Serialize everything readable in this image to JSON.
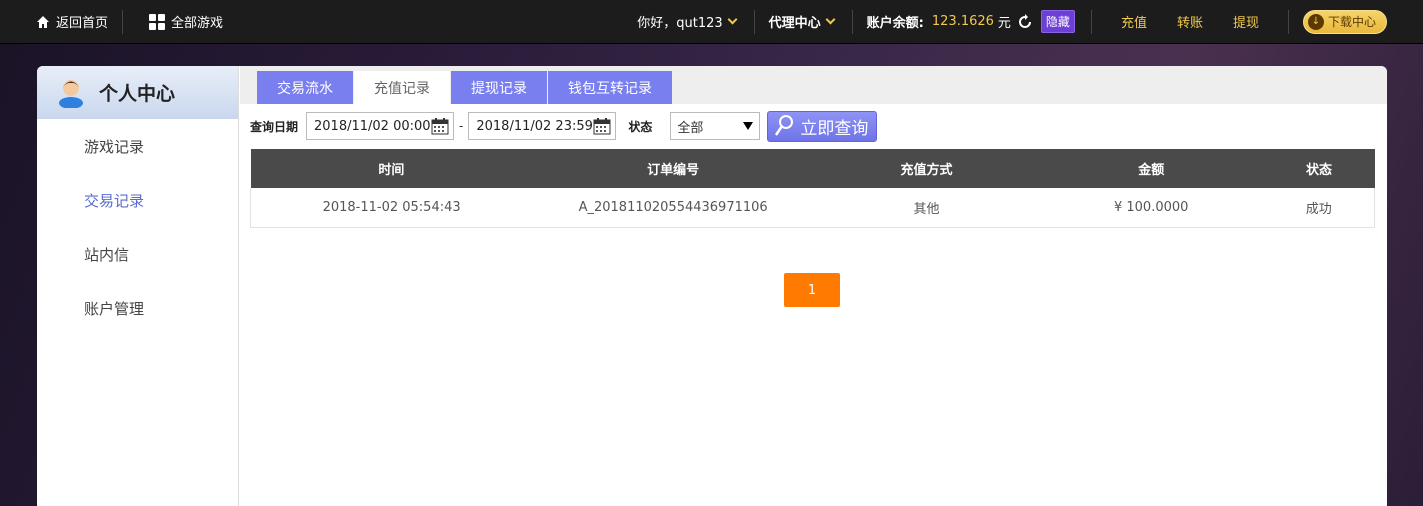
{
  "topbar": {
    "home_label": "返回首页",
    "all_games_label": "全部游戏",
    "greeting": "你好，qut123",
    "agent_center": "代理中心",
    "balance_label": "账户余额:",
    "balance_value": "123.1626",
    "balance_unit": "元",
    "hide_label": "隐藏",
    "recharge": "充值",
    "transfer": "转账",
    "withdraw": "提现",
    "download": "下载中心",
    "accent_gold": "#f2c94c",
    "hide_color": "#6c3fd6"
  },
  "sidebar": {
    "title": "个人中心",
    "items": [
      {
        "label": "游戏记录"
      },
      {
        "label": "交易记录"
      },
      {
        "label": "站内信"
      },
      {
        "label": "账户管理"
      }
    ]
  },
  "tabs": [
    {
      "label": "交易流水"
    },
    {
      "label": "充值记录"
    },
    {
      "label": "提现记录"
    },
    {
      "label": "钱包互转记录"
    }
  ],
  "filter": {
    "date_label": "查询日期",
    "date_from": "2018/11/02 00:00",
    "separator": "-",
    "date_to": "2018/11/02 23:59",
    "status_label": "状态",
    "status_value": "全部",
    "query_button": "立即查询"
  },
  "table": {
    "headers": [
      "时间",
      "订单编号",
      "充值方式",
      "金额",
      "状态"
    ],
    "rows": [
      [
        "2018-11-02 05:54:43",
        "A_2018110205544369711​06",
        "其他",
        "¥ 100.0000",
        "成功"
      ]
    ]
  },
  "pagination": {
    "current_page": "1",
    "color": "#ff7a00"
  }
}
